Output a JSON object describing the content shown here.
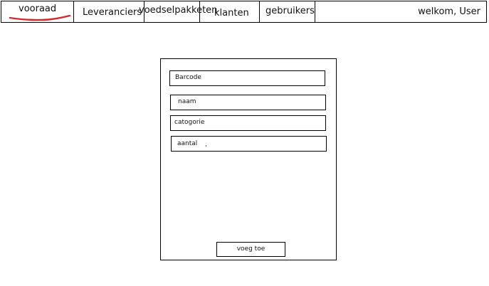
{
  "nav": {
    "items": [
      {
        "label": "vooraad",
        "active": true
      },
      {
        "label": "Leveranciers"
      },
      {
        "label": "voedselpakketen"
      },
      {
        "label": "klanten"
      },
      {
        "label": "gebruikers"
      }
    ],
    "welcome": "welkom, User",
    "active_color": "#d62828"
  },
  "form": {
    "fields": [
      {
        "placeholder": "Barcode"
      },
      {
        "placeholder": "naam"
      },
      {
        "placeholder": "catogorie"
      },
      {
        "placeholder": "aantal"
      }
    ],
    "submit_label": "voeg toe"
  }
}
